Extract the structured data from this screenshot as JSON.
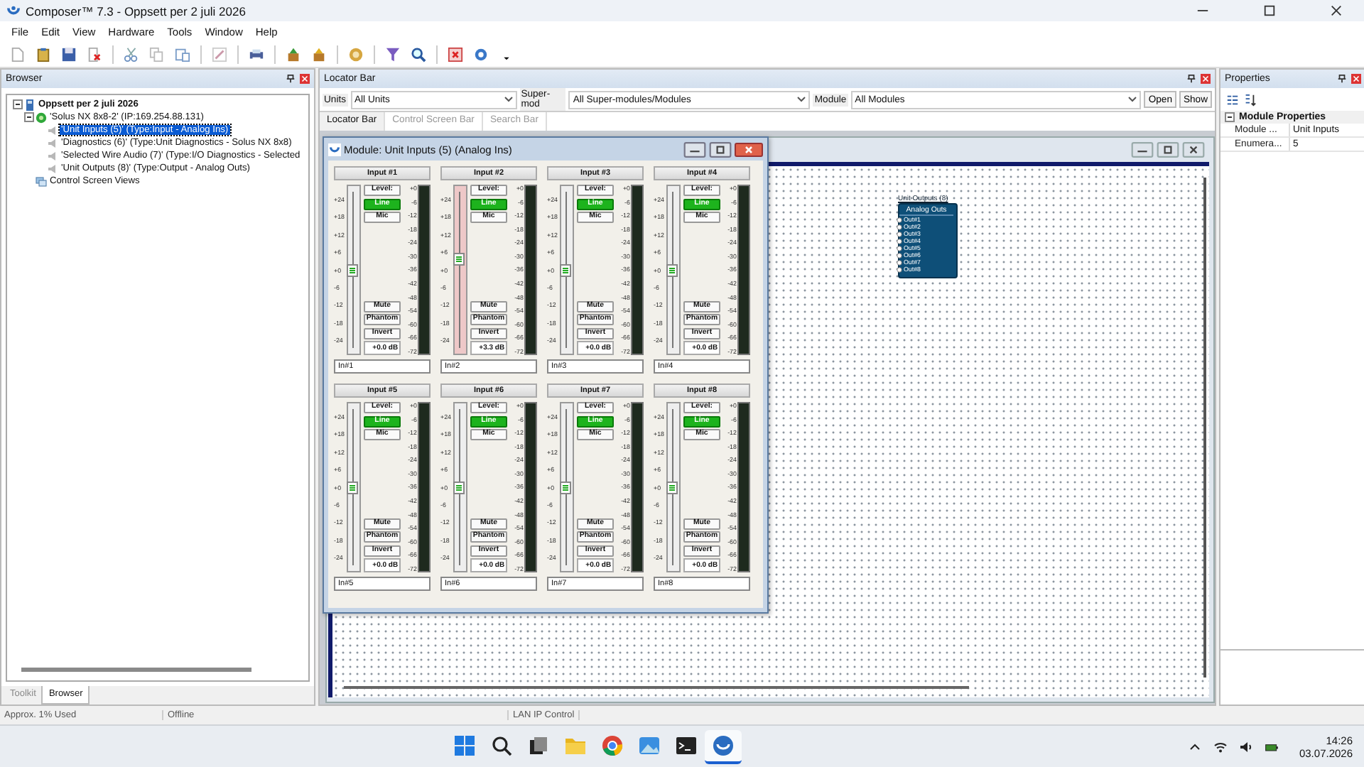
{
  "window": {
    "title": "Composer™ 7.3 - Oppsett per 2 juli 2026"
  },
  "menu": [
    "File",
    "Edit",
    "View",
    "Hardware",
    "Tools",
    "Window",
    "Help"
  ],
  "browser": {
    "title": "Browser",
    "tree": [
      {
        "label": "Oppsett per 2 juli 2026",
        "kind": "setup",
        "selected": false,
        "expanded": true,
        "children": [
          {
            "label": "'Solus NX 8x8-2' (IP:169.254.88.131)",
            "kind": "unit",
            "selected": false,
            "expanded": true,
            "children": [
              {
                "label": "'Unit Inputs (5)' (Type:Input - Analog Ins)",
                "kind": "module",
                "selected": true
              },
              {
                "label": "'Diagnostics (6)' (Type:Unit Diagnostics - Solus NX 8x8)",
                "kind": "module",
                "selected": false
              },
              {
                "label": "'Selected Wire Audio (7)' (Type:I/O Diagnostics - Selected",
                "kind": "module",
                "selected": false
              },
              {
                "label": "'Unit Outputs (8)' (Type:Output - Analog Outs)",
                "kind": "module",
                "selected": false
              }
            ]
          },
          {
            "label": "Control Screen Views",
            "kind": "views",
            "selected": false
          }
        ]
      }
    ],
    "tabs": [
      {
        "label": "Toolkit",
        "selected": false
      },
      {
        "label": "Browser",
        "selected": true
      }
    ]
  },
  "locator": {
    "title": "Locator Bar",
    "filters": [
      {
        "label": "Units",
        "value": "All Units"
      },
      {
        "label": "Super-mod",
        "value": "All Super-modules/Modules"
      },
      {
        "label": "Module",
        "value": "All Modules"
      }
    ],
    "buttons": [
      "Open",
      "Show"
    ],
    "tabs": [
      {
        "label": "Locator Bar",
        "selected": true
      },
      {
        "label": "Control Screen Bar",
        "selected": false
      },
      {
        "label": "Search Bar",
        "selected": false
      }
    ]
  },
  "module": {
    "title": "Module: Unit Inputs (5) (Analog Ins)",
    "channels": [
      {
        "title": "Input #1",
        "selected": false,
        "level": 0.5,
        "fader_scale": [
          "+24",
          "+18",
          "+12",
          "+6",
          "+0",
          "-6",
          "-12",
          "-18",
          "-24"
        ],
        "modes": [
          {
            "label": "Level:",
            "on": false
          },
          {
            "label": "Line",
            "on": true
          },
          {
            "label": "Mic",
            "on": false
          }
        ],
        "switches": [
          {
            "label": "Mute",
            "on": false
          },
          {
            "label": "Phantom",
            "on": false
          },
          {
            "label": "Invert",
            "on": false
          }
        ],
        "gain": "+0.0 dB",
        "meter_scale": [
          "+0",
          "-6",
          "-12",
          "-18",
          "-24",
          "-30",
          "-36",
          "-42",
          "-48",
          "-54",
          "-60",
          "-66",
          "-72"
        ],
        "name": "In#1"
      },
      {
        "title": "Input #2",
        "selected": true,
        "level": 0.57,
        "fader_scale": [
          "+24",
          "+18",
          "+12",
          "+6",
          "+0",
          "-6",
          "-12",
          "-18",
          "-24"
        ],
        "modes": [
          {
            "label": "Level:",
            "on": false
          },
          {
            "label": "Line",
            "on": true
          },
          {
            "label": "Mic",
            "on": false
          }
        ],
        "switches": [
          {
            "label": "Mute",
            "on": false
          },
          {
            "label": "Phantom",
            "on": false
          },
          {
            "label": "Invert",
            "on": false
          }
        ],
        "gain": "+3.3 dB",
        "meter_scale": [
          "+0",
          "-6",
          "-12",
          "-18",
          "-24",
          "-30",
          "-36",
          "-42",
          "-48",
          "-54",
          "-60",
          "-66",
          "-72"
        ],
        "name": "In#2"
      },
      {
        "title": "Input #3",
        "selected": false,
        "level": 0.5,
        "fader_scale": [
          "+24",
          "+18",
          "+12",
          "+6",
          "+0",
          "-6",
          "-12",
          "-18",
          "-24"
        ],
        "modes": [
          {
            "label": "Level:",
            "on": false
          },
          {
            "label": "Line",
            "on": true
          },
          {
            "label": "Mic",
            "on": false
          }
        ],
        "switches": [
          {
            "label": "Mute",
            "on": false
          },
          {
            "label": "Phantom",
            "on": false
          },
          {
            "label": "Invert",
            "on": false
          }
        ],
        "gain": "+0.0 dB",
        "meter_scale": [
          "+0",
          "-6",
          "-12",
          "-18",
          "-24",
          "-30",
          "-36",
          "-42",
          "-48",
          "-54",
          "-60",
          "-66",
          "-72"
        ],
        "name": "In#3"
      },
      {
        "title": "Input #4",
        "selected": false,
        "level": 0.5,
        "fader_scale": [
          "+24",
          "+18",
          "+12",
          "+6",
          "+0",
          "-6",
          "-12",
          "-18",
          "-24"
        ],
        "modes": [
          {
            "label": "Level:",
            "on": false
          },
          {
            "label": "Line",
            "on": true
          },
          {
            "label": "Mic",
            "on": false
          }
        ],
        "switches": [
          {
            "label": "Mute",
            "on": false
          },
          {
            "label": "Phantom",
            "on": false
          },
          {
            "label": "Invert",
            "on": false
          }
        ],
        "gain": "+0.0 dB",
        "meter_scale": [
          "+0",
          "-6",
          "-12",
          "-18",
          "-24",
          "-30",
          "-36",
          "-42",
          "-48",
          "-54",
          "-60",
          "-66",
          "-72"
        ],
        "name": "In#4"
      },
      {
        "title": "Input #5",
        "selected": false,
        "level": 0.5,
        "fader_scale": [
          "+24",
          "+18",
          "+12",
          "+6",
          "+0",
          "-6",
          "-12",
          "-18",
          "-24"
        ],
        "modes": [
          {
            "label": "Level:",
            "on": false
          },
          {
            "label": "Line",
            "on": true
          },
          {
            "label": "Mic",
            "on": false
          }
        ],
        "switches": [
          {
            "label": "Mute",
            "on": false
          },
          {
            "label": "Phantom",
            "on": false
          },
          {
            "label": "Invert",
            "on": false
          }
        ],
        "gain": "+0.0 dB",
        "meter_scale": [
          "+0",
          "-6",
          "-12",
          "-18",
          "-24",
          "-30",
          "-36",
          "-42",
          "-48",
          "-54",
          "-60",
          "-66",
          "-72"
        ],
        "name": "In#5"
      },
      {
        "title": "Input #6",
        "selected": false,
        "level": 0.5,
        "fader_scale": [
          "+24",
          "+18",
          "+12",
          "+6",
          "+0",
          "-6",
          "-12",
          "-18",
          "-24"
        ],
        "modes": [
          {
            "label": "Level:",
            "on": false
          },
          {
            "label": "Line",
            "on": true
          },
          {
            "label": "Mic",
            "on": false
          }
        ],
        "switches": [
          {
            "label": "Mute",
            "on": false
          },
          {
            "label": "Phantom",
            "on": false
          },
          {
            "label": "Invert",
            "on": false
          }
        ],
        "gain": "+0.0 dB",
        "meter_scale": [
          "+0",
          "-6",
          "-12",
          "-18",
          "-24",
          "-30",
          "-36",
          "-42",
          "-48",
          "-54",
          "-60",
          "-66",
          "-72"
        ],
        "name": "In#6"
      },
      {
        "title": "Input #7",
        "selected": false,
        "level": 0.5,
        "fader_scale": [
          "+24",
          "+18",
          "+12",
          "+6",
          "+0",
          "-6",
          "-12",
          "-18",
          "-24"
        ],
        "modes": [
          {
            "label": "Level:",
            "on": false
          },
          {
            "label": "Line",
            "on": true
          },
          {
            "label": "Mic",
            "on": false
          }
        ],
        "switches": [
          {
            "label": "Mute",
            "on": false
          },
          {
            "label": "Phantom",
            "on": false
          },
          {
            "label": "Invert",
            "on": false
          }
        ],
        "gain": "+0.0 dB",
        "meter_scale": [
          "+0",
          "-6",
          "-12",
          "-18",
          "-24",
          "-30",
          "-36",
          "-42",
          "-48",
          "-54",
          "-60",
          "-66",
          "-72"
        ],
        "name": "In#7"
      },
      {
        "title": "Input #8",
        "selected": false,
        "level": 0.5,
        "fader_scale": [
          "+24",
          "+18",
          "+12",
          "+6",
          "+0",
          "-6",
          "-12",
          "-18",
          "-24"
        ],
        "modes": [
          {
            "label": "Level:",
            "on": false
          },
          {
            "label": "Line",
            "on": true
          },
          {
            "label": "Mic",
            "on": false
          }
        ],
        "switches": [
          {
            "label": "Mute",
            "on": false
          },
          {
            "label": "Phantom",
            "on": false
          },
          {
            "label": "Invert",
            "on": false
          }
        ],
        "gain": "+0.0 dB",
        "meter_scale": [
          "+0",
          "-6",
          "-12",
          "-18",
          "-24",
          "-30",
          "-36",
          "-42",
          "-48",
          "-54",
          "-60",
          "-66",
          "-72"
        ],
        "name": "In#8"
      }
    ]
  },
  "canvas": {
    "node": {
      "caption": "Unit Outputs (8)",
      "title": "Analog Outs",
      "ports": [
        "Out#1",
        "Out#2",
        "Out#3",
        "Out#4",
        "Out#5",
        "Out#6",
        "Out#7",
        "Out#8"
      ]
    }
  },
  "properties": {
    "title": "Properties",
    "group": "Module Properties",
    "expanded": true,
    "rows": [
      {
        "name": "Module ...",
        "value": "Unit Inputs"
      },
      {
        "name": "Enumera...",
        "value": "5"
      }
    ]
  },
  "status_bar": [
    "Approx. 1% Used",
    "Offline",
    "LAN IP Control"
  ],
  "taskbar": {
    "apps": [
      {
        "kind": "start",
        "selected": false
      },
      {
        "kind": "search",
        "selected": false
      },
      {
        "kind": "taskview",
        "selected": false
      },
      {
        "kind": "folder",
        "selected": false
      },
      {
        "kind": "browser",
        "selected": false
      },
      {
        "kind": "photos",
        "selected": false
      },
      {
        "kind": "terminal",
        "selected": false
      },
      {
        "kind": "app",
        "selected": true
      }
    ],
    "time": "14:26",
    "date": "03.07.2026"
  }
}
